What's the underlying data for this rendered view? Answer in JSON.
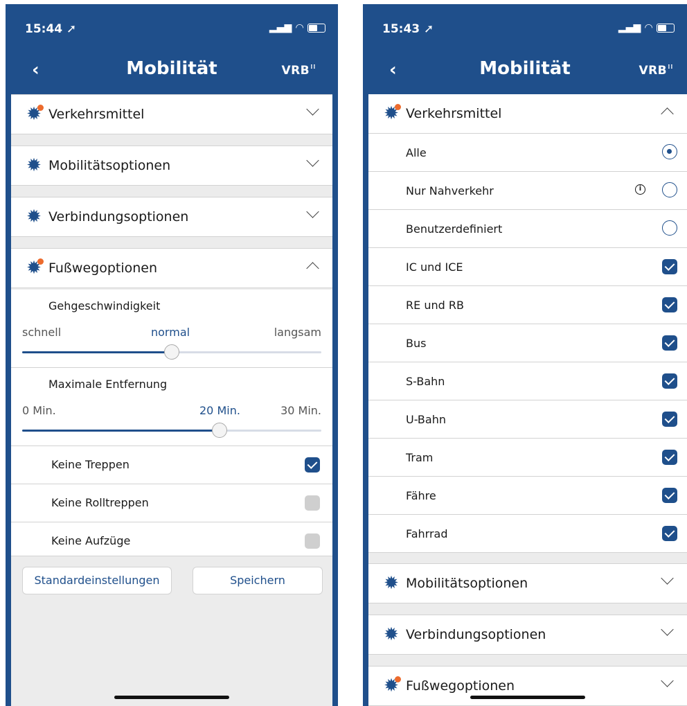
{
  "left": {
    "status": {
      "time": "15:44",
      "location_icon": "➚"
    },
    "nav": {
      "back": "‹",
      "title": "Mobilität",
      "logo": "VRB"
    },
    "sections": [
      {
        "title": "Verkehrsmittel",
        "badge": true,
        "expanded": false
      },
      {
        "title": "Mobilitätsoptionen",
        "badge": false,
        "expanded": false
      },
      {
        "title": "Verbindungsoptionen",
        "badge": false,
        "expanded": false
      },
      {
        "title": "Fußwegoptionen",
        "badge": true,
        "expanded": true
      }
    ],
    "speed": {
      "title": "Gehgeschwindigkeit",
      "min": "schnell",
      "mid": "normal",
      "max": "langsam",
      "value": 0.5
    },
    "distance": {
      "title": "Maximale Entfernung",
      "min": "0 Min.",
      "mid": "20 Min.",
      "max": "30 Min.",
      "value": 0.66
    },
    "options": [
      {
        "label": "Keine Treppen",
        "checked": true
      },
      {
        "label": "Keine Rolltreppen",
        "checked": false
      },
      {
        "label": "Keine Aufzüge",
        "checked": false
      }
    ],
    "buttons": {
      "defaults": "Standardeinstellungen",
      "save": "Speichern"
    }
  },
  "right": {
    "status": {
      "time": "15:43",
      "location_icon": "➚"
    },
    "nav": {
      "back": "‹",
      "title": "Mobilität",
      "logo": "VRB"
    },
    "verkehrsmittel": {
      "title": "Verkehrsmittel",
      "badge": true,
      "expanded": true
    },
    "radios": [
      {
        "label": "Alle",
        "selected": true
      },
      {
        "label": "Nur Nahverkehr",
        "selected": false,
        "info": true
      },
      {
        "label": "Benutzerdefiniert",
        "selected": false
      }
    ],
    "modes": [
      {
        "label": "IC und ICE",
        "checked": true
      },
      {
        "label": "RE und RB",
        "checked": true
      },
      {
        "label": "Bus",
        "checked": true
      },
      {
        "label": "S-Bahn",
        "checked": true
      },
      {
        "label": "U-Bahn",
        "checked": true
      },
      {
        "label": "Tram",
        "checked": true
      },
      {
        "label": "Fähre",
        "checked": true
      },
      {
        "label": "Fahrrad",
        "checked": true
      }
    ],
    "sections": [
      {
        "title": "Mobilitätsoptionen",
        "badge": false
      },
      {
        "title": "Verbindungsoptionen",
        "badge": false
      },
      {
        "title": "Fußwegoptionen",
        "badge": true
      }
    ]
  },
  "colors": {
    "brand": "#1f4f8b",
    "badge": "#ec6b2d"
  }
}
